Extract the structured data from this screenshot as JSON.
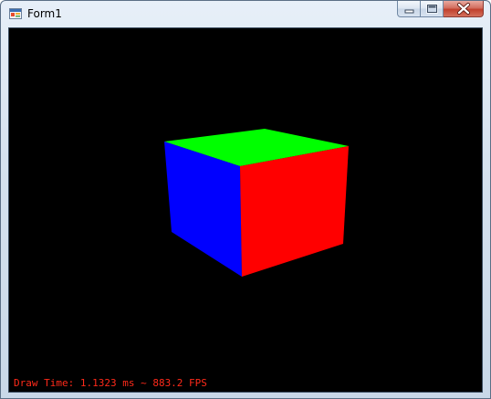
{
  "window": {
    "title": "Form1",
    "minimize_icon": "minimize-icon",
    "maximize_icon": "maximize-icon",
    "close_icon": "close-icon",
    "app_icon": "form-app-icon"
  },
  "viewport": {
    "background": "#000000",
    "status_text": "Draw Time: 1.1323 ms ~ 883.2 FPS",
    "status_color": "#ff2a1a",
    "cube_faces": {
      "top": "#00ff00",
      "left": "#0000ff",
      "right": "#ff0000"
    }
  }
}
